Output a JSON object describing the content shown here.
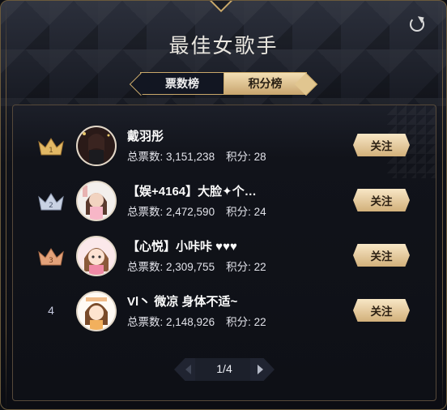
{
  "header": {
    "title": "最佳女歌手"
  },
  "tabs": [
    {
      "label": "票数榜",
      "active": false
    },
    {
      "label": "积分榜",
      "active": true
    }
  ],
  "labels": {
    "votes": "总票数",
    "points": "积分",
    "follow": "关注"
  },
  "rows": [
    {
      "rank": "1",
      "rank_style": "crown-gold",
      "name": "戴羽彤",
      "votes": "3,151,238",
      "points": "28"
    },
    {
      "rank": "2",
      "rank_style": "crown-silver",
      "name": "【娱+4164】大脸✦个…",
      "votes": "2,472,590",
      "points": "24"
    },
    {
      "rank": "3",
      "rank_style": "crown-bronze",
      "name": "【心悦】小咔咔 ♥♥♥",
      "votes": "2,309,755",
      "points": "22"
    },
    {
      "rank": "4",
      "rank_style": "number",
      "name": "Vl丶 微凉 身体不适~",
      "votes": "2,148,926",
      "points": "22"
    }
  ],
  "pagination": {
    "label": "1/4"
  },
  "colors": {
    "gold": "#c9a86a",
    "follow_bg": "#e3c794",
    "crown_gold": "#e2b865",
    "crown_silver": "#c9d2e3",
    "crown_bronze": "#e3a27a"
  }
}
